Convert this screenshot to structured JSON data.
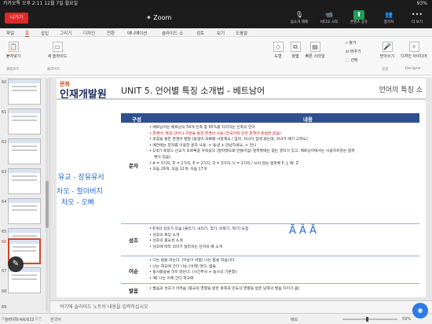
{
  "status": {
    "left": "카카오톡 오후 2:11 12월 7일 월요일",
    "battery": "93%"
  },
  "zoom": {
    "leave": "나가기",
    "title": "Zoom",
    "tools": [
      {
        "label": "음소거 해제",
        "icon": "mic-muted-icon",
        "glyph": "🎙"
      },
      {
        "label": "비디오 시작",
        "icon": "video-off-icon",
        "glyph": "📹"
      },
      {
        "label": "콘텐츠 공유",
        "icon": "share-icon",
        "glyph": "⬆"
      },
      {
        "label": "참가자",
        "icon": "participants-icon",
        "glyph": "👥"
      },
      {
        "label": "더 보기",
        "icon": "more-icon",
        "glyph": "•••"
      }
    ]
  },
  "ppt": {
    "tabs": [
      "파일",
      "홈",
      "삽입",
      "그리기",
      "디자인",
      "전환",
      "애니메이션",
      "슬라이드 쇼",
      "검토",
      "보기",
      "도움말"
    ],
    "active_tab": "홈",
    "ribbon": {
      "paste": "붙여넣기",
      "new_slide": "새 슬라이드",
      "shapes": "도형",
      "arrange": "정렬",
      "quick_styles": "빠른 스타일",
      "find": "찾기",
      "replace": "바꾸기",
      "select": "선택",
      "dictate": "받아쓰기",
      "design_ideas": "디자인 아이디어",
      "groups": [
        "클립보드",
        "슬라이드",
        "음성",
        "Designer"
      ]
    },
    "thumbs": [
      {
        "num": "60"
      },
      {
        "num": "61"
      },
      {
        "num": "62"
      },
      {
        "num": "63"
      },
      {
        "num": "64"
      },
      {
        "num": "65"
      },
      {
        "num": "66",
        "selected": true
      },
      {
        "num": "67"
      },
      {
        "num": "68"
      },
      {
        "num": "69"
      }
    ],
    "slide": {
      "logo_highlight": "문화",
      "logo": "인재개발원",
      "title": "UNIT 5. 언어별 특징 소개법 - 베트남어",
      "title_right": "언어의 특징 소",
      "table_head": {
        "col1": "구성",
        "col2": "내용"
      },
      "rows": [
        {
          "label": "문자",
          "items": [
            {
              "t": "베트남어는 베트남의 54개 민족 중 95%를 차지하는 킨족의 언어"
            },
            {
              "t": "존경어, 특정 단어나 구문을 통한 존경어 사용 (한국어와 같은 존경어 문법은 없음)"
            },
            {
              "t": "호칭을 통한 존경어 발달 (동생이 오빠를 사랑해요 / 엄마, 자녀가 집에 왔는데, 자녀가 배가 고파요)"
            },
            {
              "t": "예전에는 한자를 이용한 문자 사용 -> 동생 + 만남하세요, + 언니"
            },
            {
              "t": "1세기 프랑스 선교가 포르투갈 꾸옥응으 (알파벳으로 만들어짐/ 알파벳에는 없는 글자가 있고, 베트남어에서는 사용하지않는 알파"
            },
            {
              "t": "벳이 있음)",
              "sub": true
            },
            {
              "t": "A = 3가지, D = 2가지, E = 2가지, O = 3가지, U = 2가지 / 쓰지 않는 알파벳 F, J, W, Z"
            },
            {
              "t": "모음 29개, 모음 12개, 자음 17개"
            }
          ]
        },
        {
          "label": "성조",
          "items": [
            {
              "t": "6개의 성조가 있음 (올리기, 내리기, 꺾기, 비틀기, 찍기) 도입"
            },
            {
              "t": "성조의 특징 소개"
            },
            {
              "t": "성조의 중요성 소개"
            },
            {
              "t": "성조에 따라 의미가 달라지는 단어의 예 소개"
            }
          ]
        },
        {
          "label": "어순",
          "items": [
            {
              "t": "나는 밥을 먹는다. (어순이 바뀜)  나는 밥을 먹습니다."
            },
            {
              "t": "나는 학교에 간다                                    나는 (어제) 먹다.  밥을"
            },
            {
              "t": "동사활용을 하지 않는다. (시간부사 + 동사의 기본형)"
            },
            {
              "t": "예) 나는 어제 간다 학교에"
            }
          ]
        },
        {
          "label": "발음",
          "items": [
            {
              "t": "발음과 성조가 어려움 (중국의 영향을 받은 북쪽과 민도의 영향을 받은 남쪽의 발음 차이가 큼)"
            }
          ]
        }
      ],
      "ink": {
        "note1": "유교 - 장유유서",
        "note2": "- 차오 - 할아버지",
        "note3": "차오 - 오빠",
        "accents": "Ā  Â  Ă"
      }
    },
    "notes_placeholder": "여기에 슬라이드 노트의 내용을 입력하십시오",
    "status": {
      "slide": "슬라이드 66/112",
      "lang": "한국어",
      "notes": "메모",
      "zoom": "59%"
    }
  },
  "footer": "Bizalk Teacher의 화면"
}
